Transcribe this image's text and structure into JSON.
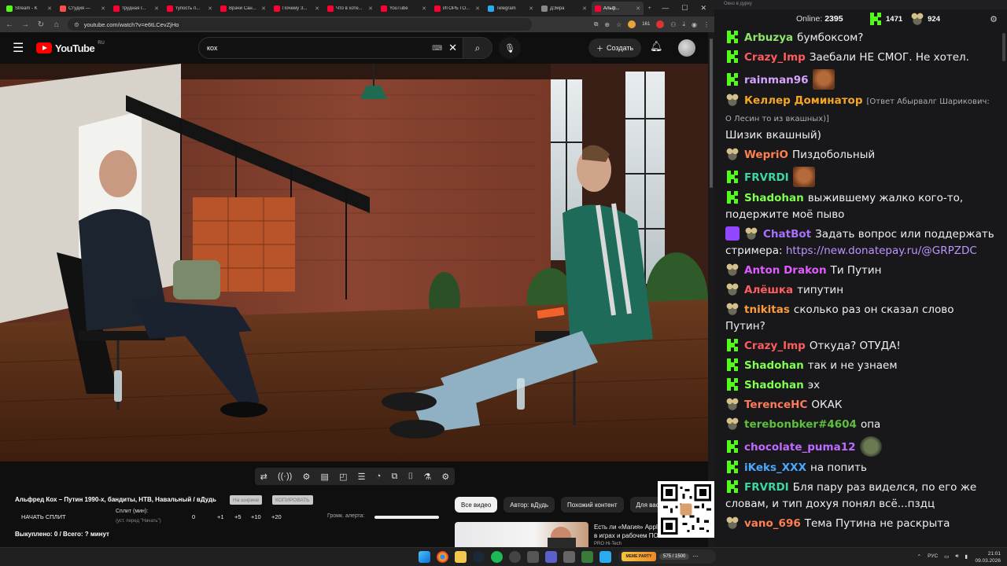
{
  "browser": {
    "tabs": [
      {
        "label": "Stream - K",
        "color": "#53fc18"
      },
      {
        "label": "Студия —",
        "color": "#ff4e4e"
      },
      {
        "label": "трудная г...",
        "color": "#ff0033"
      },
      {
        "label": "тупость п...",
        "color": "#ff0033"
      },
      {
        "label": "Врачи Сан...",
        "color": "#ff0033"
      },
      {
        "label": "Почему З...",
        "color": "#ff0033"
      },
      {
        "label": "Что в хоте...",
        "color": "#ff0033"
      },
      {
        "label": "YouTube",
        "color": "#ff0033"
      },
      {
        "label": "ИГОРЬ ГО...",
        "color": "#ff0033"
      },
      {
        "label": "Telegram",
        "color": "#2aabee"
      },
      {
        "label": "ДЭира",
        "color": "#888888"
      },
      {
        "label": "Альф...",
        "color": "#ff0033",
        "active": true
      }
    ],
    "url": "youtube.com/watch?v=e6tLCevZjHo",
    "ext_badges": [
      "161",
      "4"
    ]
  },
  "youtube": {
    "logo_text": "YouTube",
    "logo_region": "RU",
    "search_value": "кох",
    "create_label": "Создать"
  },
  "video_tools": {
    "title": "Альфред Кох – Путин 1990-х, бандиты, НТВ, Навальный / вДудь",
    "pill_1": "На ширине",
    "pill_2": "КОПИРОВАТЬ",
    "start_split": "НАЧАТЬ СПЛИТ",
    "split_label": "Сплит (мин):",
    "split_sub": "(уст. перед \"Начать\")",
    "split_values": [
      "0",
      "+1",
      "+5",
      "+10",
      "+20"
    ],
    "volume_label": "Громк. алерта:",
    "bought": "Выкуплено: 0 / Всего: ? минут"
  },
  "filters": [
    "Все видео",
    "Автор: вДудь",
    "Похожий контент",
    "Для вас"
  ],
  "recommendation": {
    "title": "Есть ли «Магия» Apple? Тест в играх и рабочем ПО...",
    "sub": "PRO Hi-Tech"
  },
  "chat": {
    "window_title": "Окно в дурку",
    "online_label": "Online:",
    "online_count": "2395",
    "kick_count": "1471",
    "mouse_count": "924",
    "messages": [
      {
        "badge": "kick",
        "nick": "Arbuzya",
        "color": "#8fe36b",
        "text": "бумбоксом?"
      },
      {
        "badge": "kick",
        "nick": "Crazy_Imp",
        "color": "#ff5c5c",
        "text": "Заебали НЕ СМОГ. Не хотел."
      },
      {
        "badge": "kick",
        "nick": "rainman96",
        "color": "#d6a4ff",
        "text": "",
        "emote": "face"
      },
      {
        "badge": "mouse",
        "nick": "Келлер Доминатор",
        "color": "#f5a623",
        "reply": "[Ответ Абырвалг Шарикович: О Лесин то из вкашных)]",
        "text": "Шизик вкашный)"
      },
      {
        "badge": "mouse",
        "nick": "WepriO",
        "color": "#ff7f50",
        "text": "Пиздобольный"
      },
      {
        "badge": "kick",
        "nick": "FRVRDI",
        "color": "#3ed6a0",
        "text": "",
        "emote": "face"
      },
      {
        "badge": "kick",
        "nick": "Shadohan",
        "color": "#7fff4f",
        "text": "выжившему жалко кого-то, подержите моё пыво"
      },
      {
        "badge": "bot",
        "nick": "ChatBot",
        "color": "#a970ff",
        "text": "Задать вопрос или поддержать стримера: ",
        "link": "https://new.donatepay.ru/@GRPZDC"
      },
      {
        "badge": "mouse",
        "nick": "Anton Drakon",
        "color": "#e05cff",
        "text": "Ти Путин"
      },
      {
        "badge": "mouse",
        "nick": "Алёшка",
        "color": "#ff5f5f",
        "text": "типутин"
      },
      {
        "badge": "mouse",
        "nick": "tnikitas",
        "color": "#ff9b3d",
        "text": "сколько раз он сказал слово Путин?"
      },
      {
        "badge": "kick",
        "nick": "Crazy_Imp",
        "color": "#ff5c5c",
        "text": "Откуда? ОТУДА!"
      },
      {
        "badge": "kick",
        "nick": "Shadohan",
        "color": "#7fff4f",
        "text": "так и не узнаем"
      },
      {
        "badge": "kick",
        "nick": "Shadohan",
        "color": "#7fff4f",
        "text": "эх"
      },
      {
        "badge": "mouse",
        "nick": "TerenceHC",
        "color": "#ff7a59",
        "text": "ОКАК"
      },
      {
        "badge": "mouse",
        "nick": "terebonbker#4604",
        "color": "#5fbf3f",
        "text": "опа"
      },
      {
        "badge": "kick",
        "nick": "chocolate_puma12",
        "color": "#c06bff",
        "text": "",
        "emote": "pepe"
      },
      {
        "badge": "kick",
        "nick": "iKeks_XXX",
        "color": "#4aa8ff",
        "text": "на попить"
      },
      {
        "badge": "kick",
        "nick": "FRVRDI",
        "color": "#3ed6a0",
        "text": "Бля пару раз виделся, по его же словам, и тип дохуя понял всё...пздц"
      },
      {
        "badge": "mouse",
        "nick": "vano_696",
        "color": "#ff7f50",
        "text": "Тема Путина не раскрыта"
      }
    ]
  },
  "taskbar": {
    "meme_label": "MEME PARTY",
    "meme_count": "575 / 1500",
    "lang": "РУС",
    "time": "21:01",
    "date": "09.03.2026"
  }
}
